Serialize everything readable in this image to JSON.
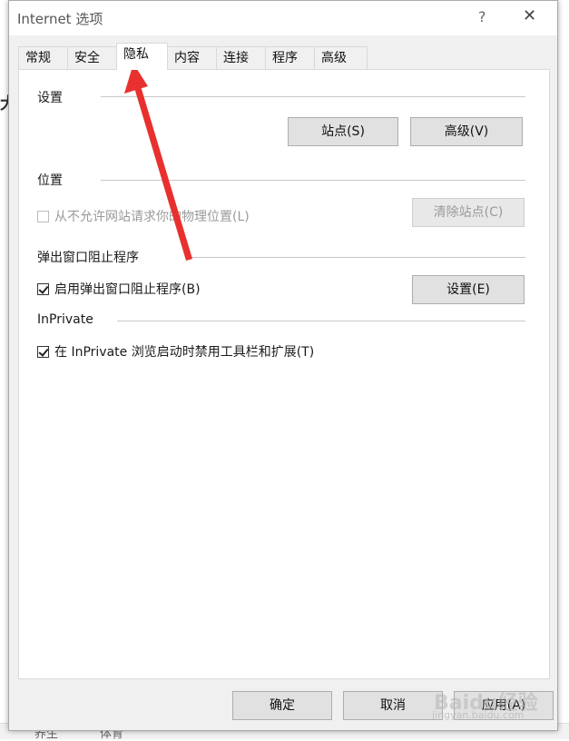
{
  "dialog": {
    "title": "Internet 选项",
    "help_glyph": "?",
    "close_glyph": "✕"
  },
  "tabs": [
    {
      "label": "常规"
    },
    {
      "label": "安全"
    },
    {
      "label": "隐私",
      "active": true
    },
    {
      "label": "内容"
    },
    {
      "label": "连接"
    },
    {
      "label": "程序"
    },
    {
      "label": "高级"
    }
  ],
  "sections": {
    "settings": {
      "label": "设置",
      "sites_button": "站点(S)",
      "advanced_button": "高级(V)"
    },
    "location": {
      "label": "位置",
      "checkbox_label": "从不允许网站请求你的物理位置(L)",
      "checked": false,
      "clear_sites_button": "清除站点(C)"
    },
    "popup_blocker": {
      "label": "弹出窗口阻止程序",
      "checkbox_label": "启用弹出窗口阻止程序(B)",
      "checked": true,
      "settings_button": "设置(E)"
    },
    "inprivate": {
      "label": "InPrivate",
      "checkbox_label": "在 InPrivate 浏览启动时禁用工具栏和扩展(T)",
      "checked": true
    }
  },
  "footer": {
    "ok_button": "确定",
    "cancel_button": "取消",
    "apply_button": "应用(A)"
  },
  "watermark": {
    "text": "Baidu经验",
    "sub": "jingyan.baidu.com"
  },
  "background_fragments": {
    "f1": "大",
    "f2": "养生",
    "f3": "体育"
  },
  "colors": {
    "annotation_arrow": "#e8312f"
  }
}
